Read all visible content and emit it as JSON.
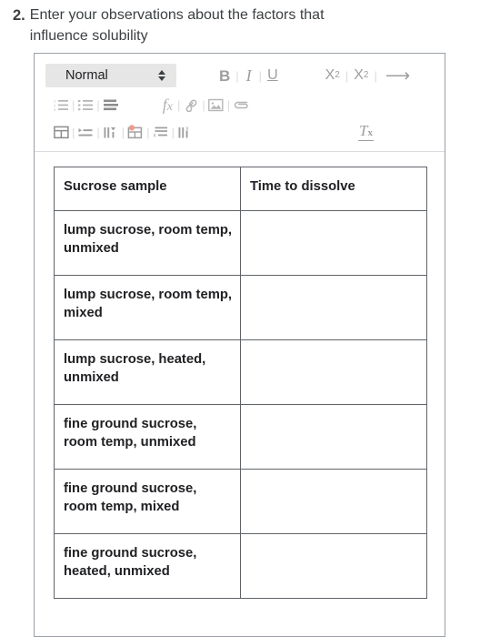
{
  "question": {
    "number": "2.",
    "text": "Enter your observations about the factors that influence solubility"
  },
  "editor": {
    "toolbar": {
      "style_dropdown": {
        "value": "Normal",
        "icon": "spinner-updown-icon"
      },
      "row1": [
        {
          "name": "bold-button",
          "label": "B"
        },
        {
          "name": "italic-button",
          "label": "I"
        },
        {
          "name": "underline-button",
          "label": "U"
        },
        {
          "name": "subscript-button",
          "label": "X2"
        },
        {
          "name": "superscript-button",
          "label": "X2sup"
        },
        {
          "name": "insert-arrow-button",
          "label": "⟶"
        }
      ],
      "row2": [
        {
          "name": "numbered-list-button",
          "label": "numbered-list-icon"
        },
        {
          "name": "bulleted-list-button",
          "label": "bulleted-list-icon"
        },
        {
          "name": "align-button",
          "label": "align-icon"
        },
        {
          "name": "formula-button",
          "label": "fx"
        },
        {
          "name": "link-button",
          "label": "link-icon"
        },
        {
          "name": "image-button",
          "label": "image-icon"
        },
        {
          "name": "attachment-button",
          "label": "paperclip-icon"
        }
      ],
      "row3": [
        {
          "name": "insert-table-button",
          "label": "table-icon"
        },
        {
          "name": "insert-row-button",
          "label": "insert-row-icon"
        },
        {
          "name": "insert-column-button",
          "label": "insert-column-icon"
        },
        {
          "name": "merge-cells-button",
          "label": "merge-cells-icon"
        },
        {
          "name": "delete-row-button",
          "label": "delete-row-icon"
        },
        {
          "name": "delete-column-button",
          "label": "delete-column-icon"
        },
        {
          "name": "clear-formatting-button",
          "label": "Tx"
        }
      ],
      "separator": "|"
    },
    "table": {
      "headers": [
        "Sucrose sample",
        "Time to dissolve"
      ],
      "rows": [
        {
          "sample": "lump sucrose, room temp, unmixed",
          "time": ""
        },
        {
          "sample": "lump sucrose, room temp, mixed",
          "time": ""
        },
        {
          "sample": "lump sucrose, heated, unmixed",
          "time": ""
        },
        {
          "sample": "fine ground sucrose, room temp, unmixed",
          "time": ""
        },
        {
          "sample": "fine ground sucrose, room temp, mixed",
          "time": ""
        },
        {
          "sample": "fine ground sucrose, heated, unmixed",
          "time": ""
        }
      ]
    }
  },
  "colors": {
    "text": "#3c4043",
    "table_border": "#5f6368",
    "editor_border": "#9aa0a6",
    "toolbar_icon": "#b5b5b5",
    "dropdown_bg": "#e6e6e6",
    "merge_accent": "#e8867a"
  }
}
